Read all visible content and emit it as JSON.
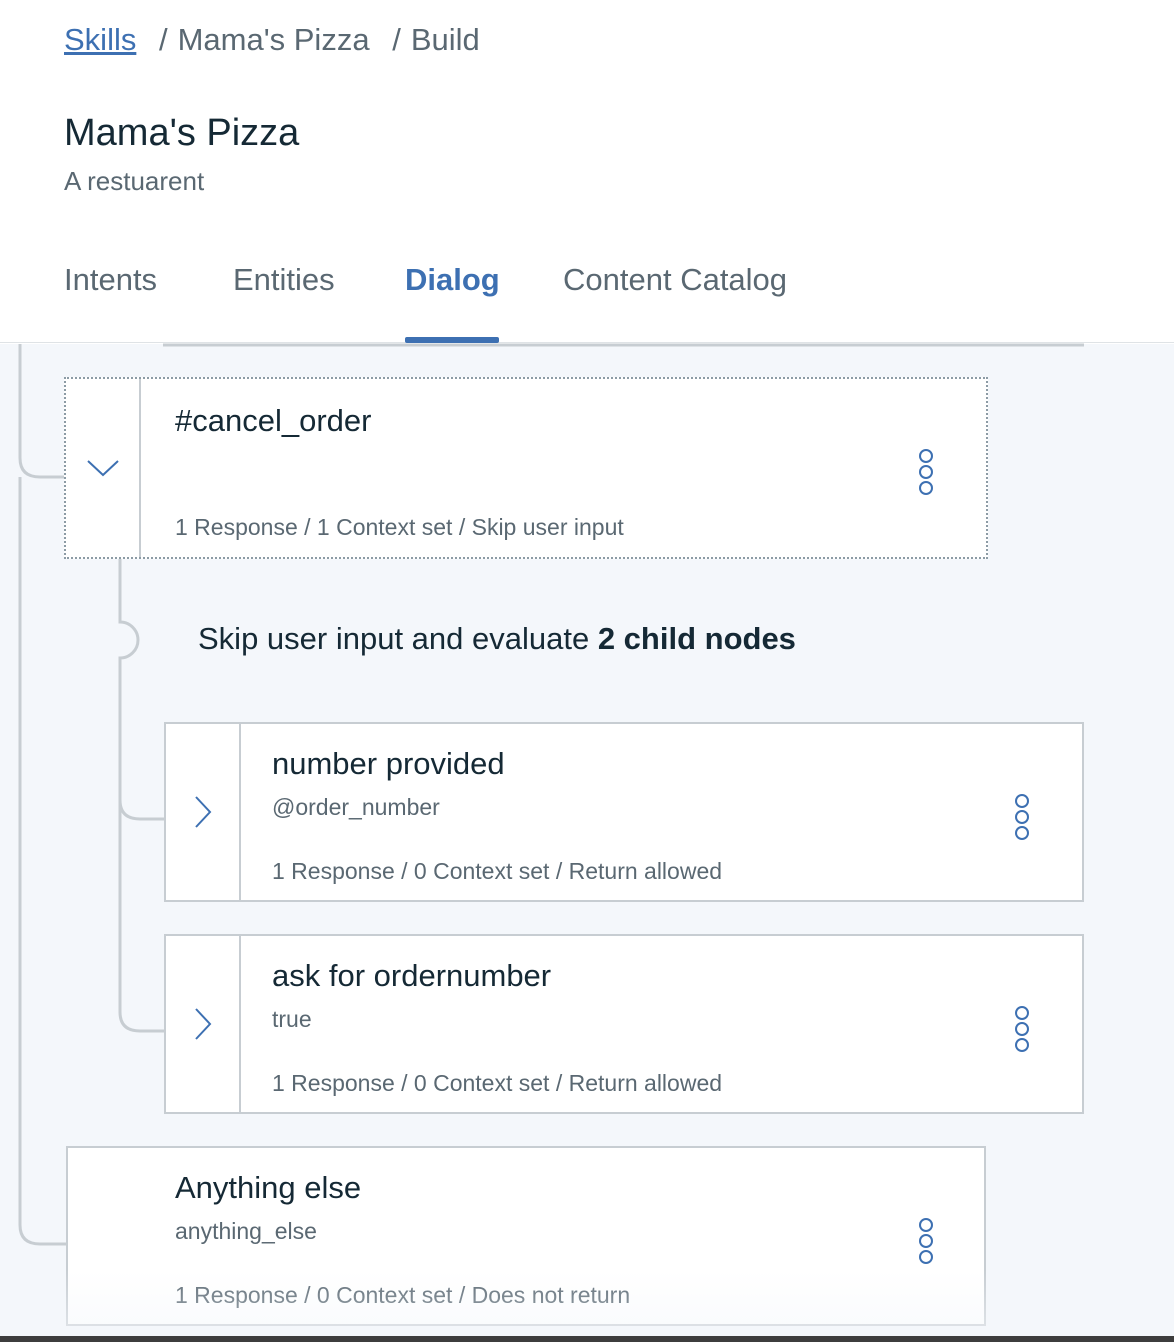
{
  "breadcrumb": {
    "skills_link": "Skills",
    "separator": "/",
    "skill_name": "Mama's Pizza",
    "page": "Build"
  },
  "skill": {
    "title": "Mama's Pizza",
    "description": "A restuarent"
  },
  "tabs": [
    {
      "label": "Intents",
      "active": false
    },
    {
      "label": "Entities",
      "active": false
    },
    {
      "label": "Dialog",
      "active": true
    },
    {
      "label": "Content Catalog",
      "active": false
    }
  ],
  "nodes": {
    "cancel_order": {
      "title": "#cancel_order",
      "condition": "",
      "meta": "1 Response / 1 Context set / Skip user input",
      "expanded": true,
      "toggle_icon": "chevron-down-icon"
    },
    "number_provided": {
      "title": "number provided",
      "condition": "@order_number",
      "meta": "1 Response / 0 Context set / Return allowed",
      "toggle_icon": "chevron-right-icon"
    },
    "ask_for_ordernumber": {
      "title": "ask for ordernumber",
      "condition": "true",
      "meta": "1 Response / 0 Context set / Return allowed",
      "toggle_icon": "chevron-right-icon"
    },
    "anything_else": {
      "title": "Anything else",
      "condition": "anything_else",
      "meta": "1 Response / 0 Context set / Does not return"
    }
  },
  "skip_note": {
    "prefix": "Skip user input and evaluate ",
    "emphasis": "2 child nodes"
  },
  "icons": {
    "node_menu": "overflow-menu-icon"
  },
  "colors": {
    "accent": "#3d70b2",
    "canvas_bg": "#f4f7fb",
    "text_primary": "#152935",
    "text_secondary": "#5a6872",
    "tree_line": "#c7cdd2"
  }
}
